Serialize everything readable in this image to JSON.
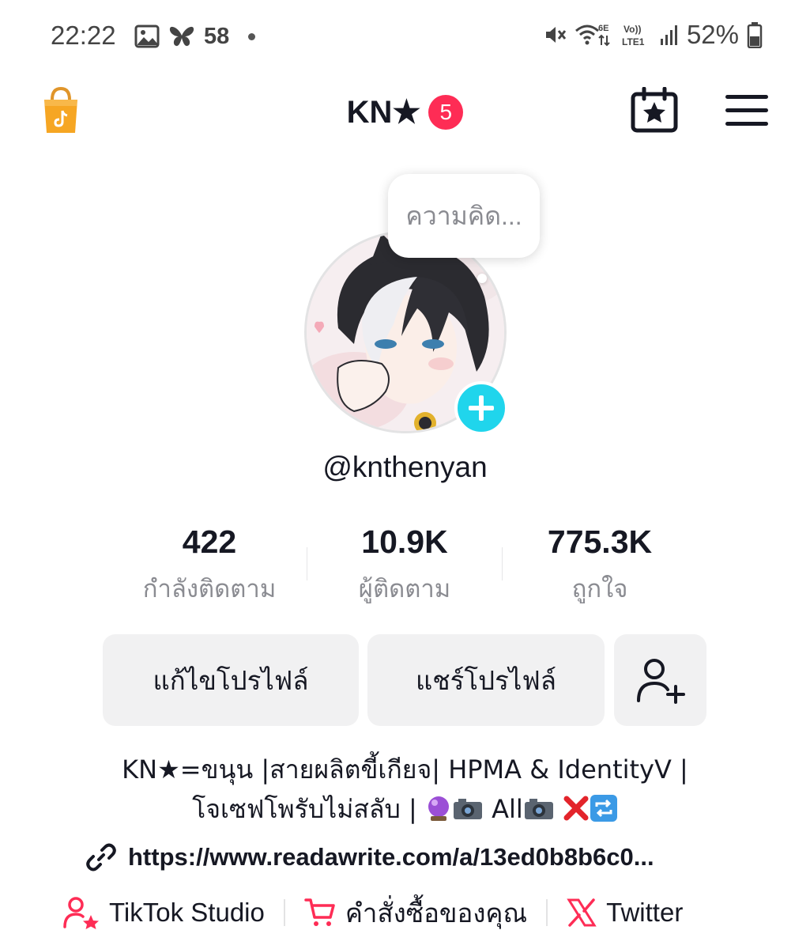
{
  "status_bar": {
    "time": "22:22",
    "notification_count": "58",
    "battery_percent": "52%"
  },
  "header": {
    "title": "KN★",
    "badge_count": "5"
  },
  "profile": {
    "thought_placeholder": "ความคิด...",
    "handle": "@knthenyan"
  },
  "stats": [
    {
      "value": "422",
      "label": "กำลังติดตาม"
    },
    {
      "value": "10.9K",
      "label": "ผู้ติดตาม"
    },
    {
      "value": "775.3K",
      "label": "ถูกใจ"
    }
  ],
  "buttons": {
    "edit_profile": "แก้ไขโปรไฟล์",
    "share_profile": "แชร์โปรไฟล์"
  },
  "bio": {
    "line1": "KN★=ขนุน |สายผลิตขี้เกียจ| HPMA & IdentityV |",
    "line2_text": "โจเซฟโพรับไม่สลับ | ",
    "line2_all": " All",
    "line2_end": " "
  },
  "link": "https://www.readawrite.com/a/13ed0b8b6c0...",
  "bottom_links": {
    "studio": "TikTok Studio",
    "orders": "คำสั่งซื้อของคุณ",
    "twitter": "Twitter"
  },
  "colors": {
    "accent_red": "#fe2c55",
    "accent_cyan": "#20d5ec",
    "text": "#161823",
    "muted": "#8a8b91",
    "button_bg": "#f1f1f2"
  }
}
